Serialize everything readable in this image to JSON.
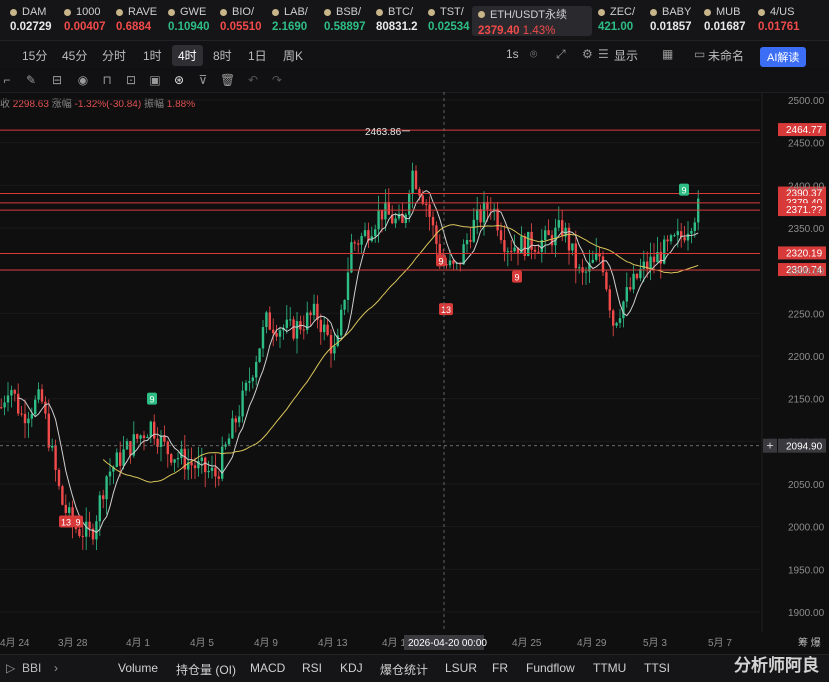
{
  "tickers": [
    {
      "name": "DAM",
      "price": "0.02729",
      "trend": "neutral"
    },
    {
      "name": "1000",
      "price": "0.00407",
      "trend": "down"
    },
    {
      "name": "RAVE",
      "price": "0.6884",
      "trend": "down"
    },
    {
      "name": "GWE",
      "price": "0.10940",
      "trend": "up"
    },
    {
      "name": "BIO/",
      "price": "0.05510",
      "trend": "down"
    },
    {
      "name": "LAB/",
      "price": "2.1690",
      "trend": "up"
    },
    {
      "name": "BSB/",
      "price": "0.58897",
      "trend": "up"
    },
    {
      "name": "BTC/",
      "price": "80831.2",
      "trend": "neutral"
    },
    {
      "name": "TST/",
      "price": "0.02534",
      "trend": "up"
    },
    {
      "name": "ETH/USDT永续",
      "price": "2379.40",
      "change": "1.43%",
      "trend": "down",
      "active": true
    },
    {
      "name": "ZEC/",
      "price": "421.00",
      "trend": "up"
    },
    {
      "name": "BABY",
      "price": "0.01857",
      "trend": "neutral"
    },
    {
      "name": "MUB",
      "price": "0.01687",
      "trend": "neutral"
    },
    {
      "name": "4/US",
      "price": "0.01761",
      "trend": "down"
    }
  ],
  "timeframes": [
    "15分",
    "45分",
    "分时",
    "1时",
    "4时",
    "8时",
    "1日",
    "周K"
  ],
  "active_timeframe": "4时",
  "toolbar_right": {
    "interval": "1s",
    "display": "显示",
    "layout_name": "未命名",
    "ai": "AI解读"
  },
  "info": {
    "close_label": "收",
    "close": "2298.63",
    "change_label": "涨幅",
    "change": "-1.32%(-30.84)",
    "amp_label": "振幅",
    "amp": "1.88%"
  },
  "chart_data": {
    "type": "candlestick",
    "y_ticks": [
      "2500.00",
      "2450.00",
      "2400.00",
      "2350.00",
      "2300.00",
      "2250.00",
      "2200.00",
      "2150.00",
      "2100.00",
      "2050.00",
      "2000.00",
      "1950.00",
      "1900.00"
    ],
    "ylim": [
      1900,
      2500
    ],
    "x_ticks": [
      "4月 24",
      "3月 28",
      "4月 1",
      "4月 5",
      "4月 9",
      "4月 13",
      "4月 1",
      "4月 25",
      "4月 29",
      "5月 3",
      "5月 7"
    ],
    "crosshair": {
      "x_label": "2026-04-20 00:00",
      "y_label": "2094.90"
    },
    "high_marker": "2463.86",
    "price_lines": [
      {
        "label": "2464.77",
        "value": 2464.77
      },
      {
        "label": "2390.37",
        "value": 2390.37
      },
      {
        "label": "2379.40",
        "value": 2379.4
      },
      {
        "label": "2371.??",
        "value": 2371.0
      },
      {
        "label": "2320.19",
        "value": 2320.19
      },
      {
        "label": "2300.74",
        "value": 2300.74
      }
    ],
    "td_markers": [
      {
        "text": "9",
        "kind": "buy"
      },
      {
        "text": "9",
        "kind": "buy"
      },
      {
        "text": "13",
        "kind": "sell"
      },
      {
        "text": "9",
        "kind": "sell"
      },
      {
        "text": "9",
        "kind": "sell"
      },
      {
        "text": "13",
        "kind": "sell"
      },
      {
        "text": "9",
        "kind": "sell"
      }
    ]
  },
  "axis_right_extra": "筹  爆",
  "indicators": [
    "BBI",
    "Volume",
    "持仓量 (OI)",
    "MACD",
    "RSI",
    "KDJ",
    "爆仓统计",
    "LSUR",
    "FR",
    "Fundflow",
    "TTMU",
    "TTSI"
  ],
  "watermark": "分析师阿良"
}
